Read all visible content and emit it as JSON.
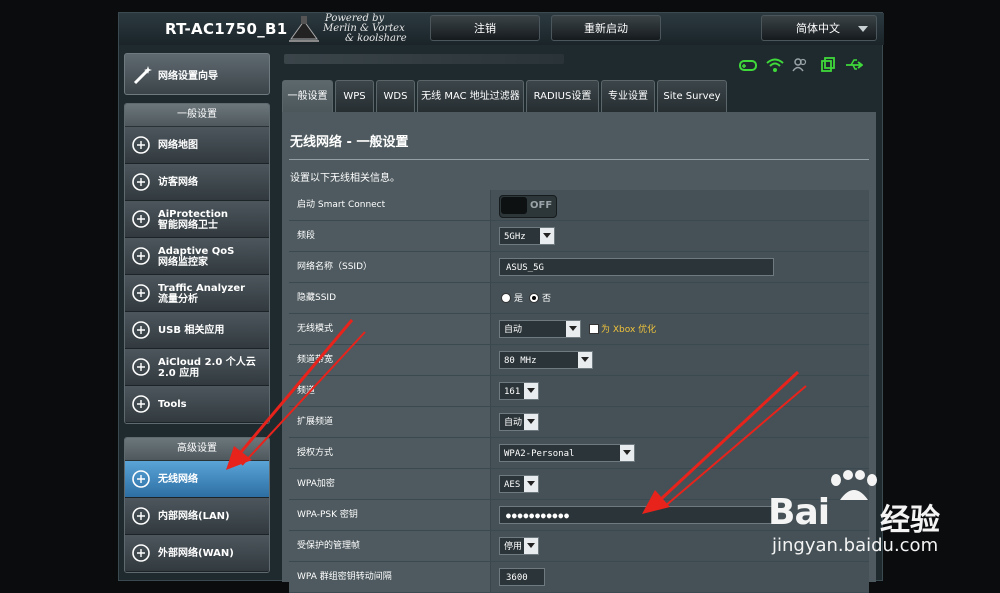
{
  "header": {
    "model": "RT-AC1750_B1",
    "powered_by": [
      "Powered by",
      "Merlin & Vortex",
      "& koolshare"
    ],
    "logout": "注销",
    "reboot": "重新启动",
    "language": "简体中文"
  },
  "sidebar": {
    "quick_setup": "网络设置向导",
    "general_header": "一般设置",
    "general_items": [
      {
        "label1": "网络地图",
        "label2": ""
      },
      {
        "label1": "访客网络",
        "label2": ""
      },
      {
        "label1": "AiProtection",
        "label2": "智能网络卫士"
      },
      {
        "label1": "Adaptive QoS",
        "label2": "网络监控家"
      },
      {
        "label1": "Traffic Analyzer",
        "label2": "流量分析"
      },
      {
        "label1": "USB 相关应用",
        "label2": ""
      },
      {
        "label1": "AiCloud 2.0 个人云",
        "label2": "2.0 应用"
      },
      {
        "label1": "Tools",
        "label2": ""
      }
    ],
    "advanced_header": "高级设置",
    "advanced_items": [
      {
        "label1": "无线网络",
        "label2": ""
      },
      {
        "label1": "内部网络(LAN)",
        "label2": ""
      },
      {
        "label1": "外部网络(WAN)",
        "label2": ""
      }
    ]
  },
  "tabs": [
    "一般设置",
    "WPS",
    "WDS",
    "无线 MAC 地址过滤器",
    "RADIUS设置",
    "专业设置",
    "Site Survey"
  ],
  "panel": {
    "title": "无线网络 - 一般设置",
    "description": "设置以下无线相关信息。"
  },
  "form": {
    "smart_connect_label": "启动 Smart Connect",
    "smart_connect_state": "OFF",
    "band_label": "频段",
    "band_value": "5GHz",
    "ssid_label": "网络名称（SSID）",
    "ssid_value": "ASUS_5G",
    "hide_ssid_label": "隐藏SSID",
    "hide_yes": "是",
    "hide_no": "否",
    "mode_label": "无线模式",
    "mode_value": "自动",
    "xbox_label": "为 Xbox 优化",
    "bandwidth_label": "频道带宽",
    "bandwidth_value": "80 MHz",
    "channel_label": "频道",
    "channel_value": "161",
    "ext_channel_label": "扩展频道",
    "ext_channel_value": "自动",
    "auth_label": "授权方式",
    "auth_value": "WPA2-Personal",
    "wpa_enc_label": "WPA加密",
    "wpa_enc_value": "AES",
    "psk_label": "WPA-PSK 密钥",
    "psk_value": "●●●●●●●●●●●",
    "pmf_label": "受保护的管理帧",
    "pmf_value": "停用",
    "group_key_label": "WPA 群组密钥转动间隔",
    "group_key_value": "3600"
  },
  "watermark": {
    "brand": "Bai",
    "brand_cn": "经验",
    "url": "jingyan.baidu.com"
  },
  "colors": {
    "active_blue": "#3a86c0",
    "arrow_red": "#e8231c",
    "xbox_gold": "#f0c23c",
    "status_green": "#3fd93a"
  }
}
